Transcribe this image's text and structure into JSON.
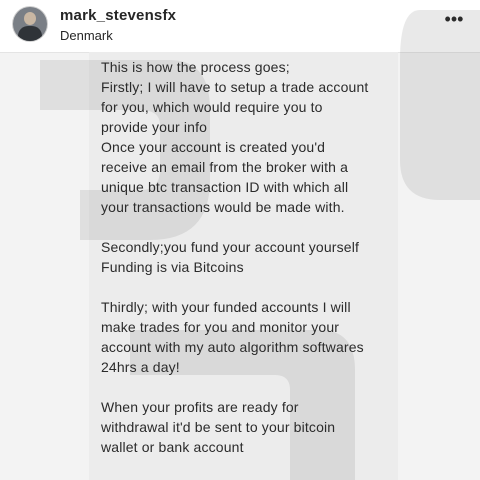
{
  "post": {
    "username": "mark_stevensfx",
    "location": "Denmark",
    "more_icon": "more-horizontal-icon",
    "more_glyph": "•••"
  },
  "message": {
    "lines": [
      "This is how the process goes;",
      "Firstly; I will have to setup a trade account",
      "for you, which would require you to",
      "provide your info",
      "Once your account is created you'd",
      "receive an email from the broker with a",
      "unique btc transaction ID with which all",
      "your transactions would be made with.",
      "",
      "Secondly;you fund your account yourself",
      "Funding is via Bitcoins",
      "",
      "Thirdly; with your funded accounts I will",
      "make trades for you and monitor your",
      "account with my auto algorithm softwares",
      "24hrs a day!",
      "",
      "When your profits are ready for",
      "withdrawal it'd be sent to your bitcoin",
      "wallet or bank account"
    ]
  },
  "colors": {
    "background": "#f3f3f3",
    "bubble": "#ececec",
    "text": "#2b2b2b",
    "header": "#ffffff"
  }
}
